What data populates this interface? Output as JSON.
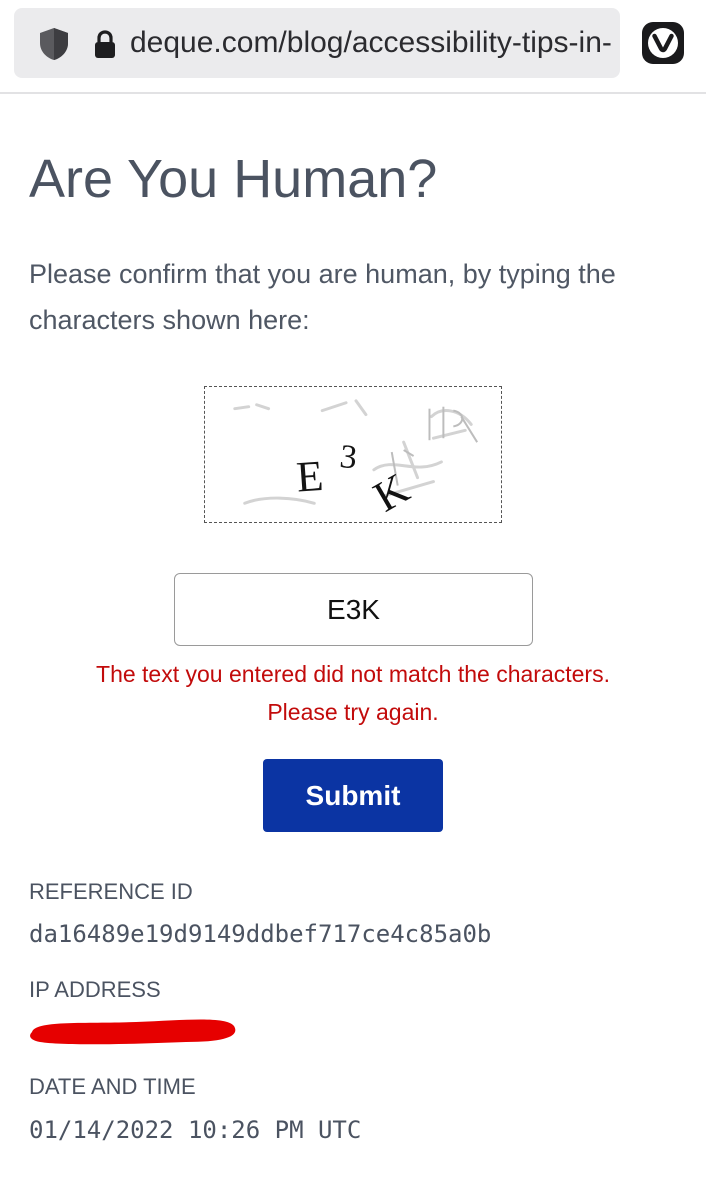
{
  "browser": {
    "url": "deque.com/blog/accessibility-tips-in-",
    "site_icon": "shield-icon",
    "secure_icon": "lock-icon",
    "menu_icon": "vivaldi-icon"
  },
  "page": {
    "title": "Are You Human?",
    "intro": "Please confirm that you are human, by typing the characters shown here:"
  },
  "captcha": {
    "image_text": "E3K",
    "input_value": "E3K",
    "error_line_1": "The text you entered did not match the characters.",
    "error_line_2": "Please try again."
  },
  "form": {
    "submit_label": "Submit"
  },
  "info": {
    "reference_label": "REFERENCE ID",
    "reference_value": "da16489e19d9149ddbef717ce4c85a0b",
    "ip_label": "IP ADDRESS",
    "date_label": "DATE AND TIME",
    "date_value": "01/14/2022 10:26 PM UTC"
  },
  "colors": {
    "accent_button": "#0b34a3",
    "error_text": "#c20b0b",
    "redaction": "#e60000"
  }
}
